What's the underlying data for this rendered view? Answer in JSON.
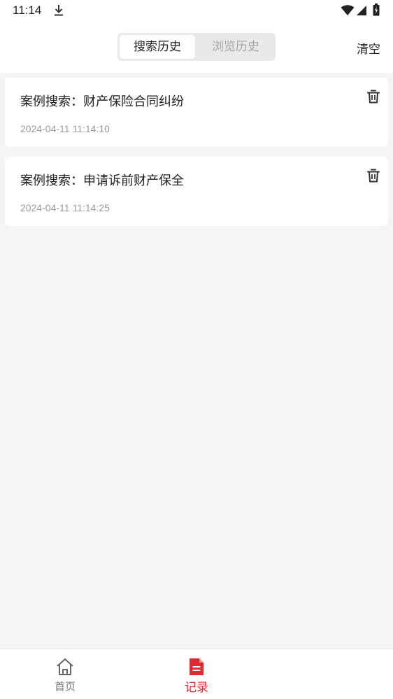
{
  "status_bar": {
    "time": "11:14",
    "icons": [
      "download-icon",
      "wifi-icon",
      "signal-icon",
      "battery-icon"
    ]
  },
  "header": {
    "tabs": [
      {
        "label": "搜索历史",
        "active": true
      },
      {
        "label": "浏览历史",
        "active": false
      }
    ],
    "clear_label": "清空"
  },
  "history": [
    {
      "title": "案例搜索：财产保险合同纠纷",
      "time": "2024-04-11 11:14:10",
      "icon": "trash-icon"
    },
    {
      "title": "案例搜索：申请诉前财产保全",
      "time": "2024-04-11 11:14:25",
      "icon": "trash-icon"
    }
  ],
  "bottom_nav": {
    "items": [
      {
        "label": "首页",
        "icon": "home-icon",
        "active": false
      },
      {
        "label": "记录",
        "icon": "document-icon",
        "active": true
      }
    ]
  },
  "colors": {
    "accent": "#e0282e",
    "background": "#f4f4f4",
    "card": "#ffffff",
    "muted_text": "#999999"
  }
}
